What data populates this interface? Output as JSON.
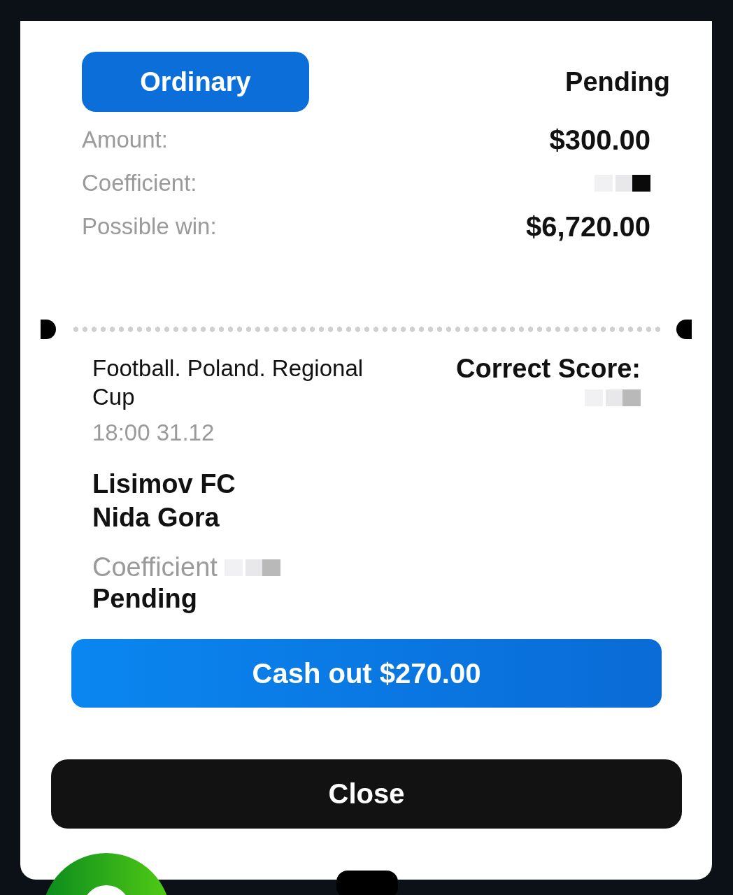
{
  "bet": {
    "type_label": "Ordinary",
    "status": "Pending"
  },
  "details": [
    {
      "kind": "text",
      "label": "Amount:",
      "value": "$300.00"
    },
    {
      "kind": "redacted",
      "label": "Coefficient:"
    },
    {
      "kind": "text",
      "label": "Possible win:",
      "value": "$6,720.00"
    }
  ],
  "event": {
    "title": "Football. Poland. Regional Cup",
    "time": "18:00 31.12",
    "teams": [
      "Lisimov FC",
      "Nida Gora"
    ],
    "market": "Correct Score:",
    "coefficient_label": "Coefficient",
    "status": "Pending"
  },
  "buttons": {
    "cash_out": "Cash out $270.00",
    "close": "Close"
  }
}
